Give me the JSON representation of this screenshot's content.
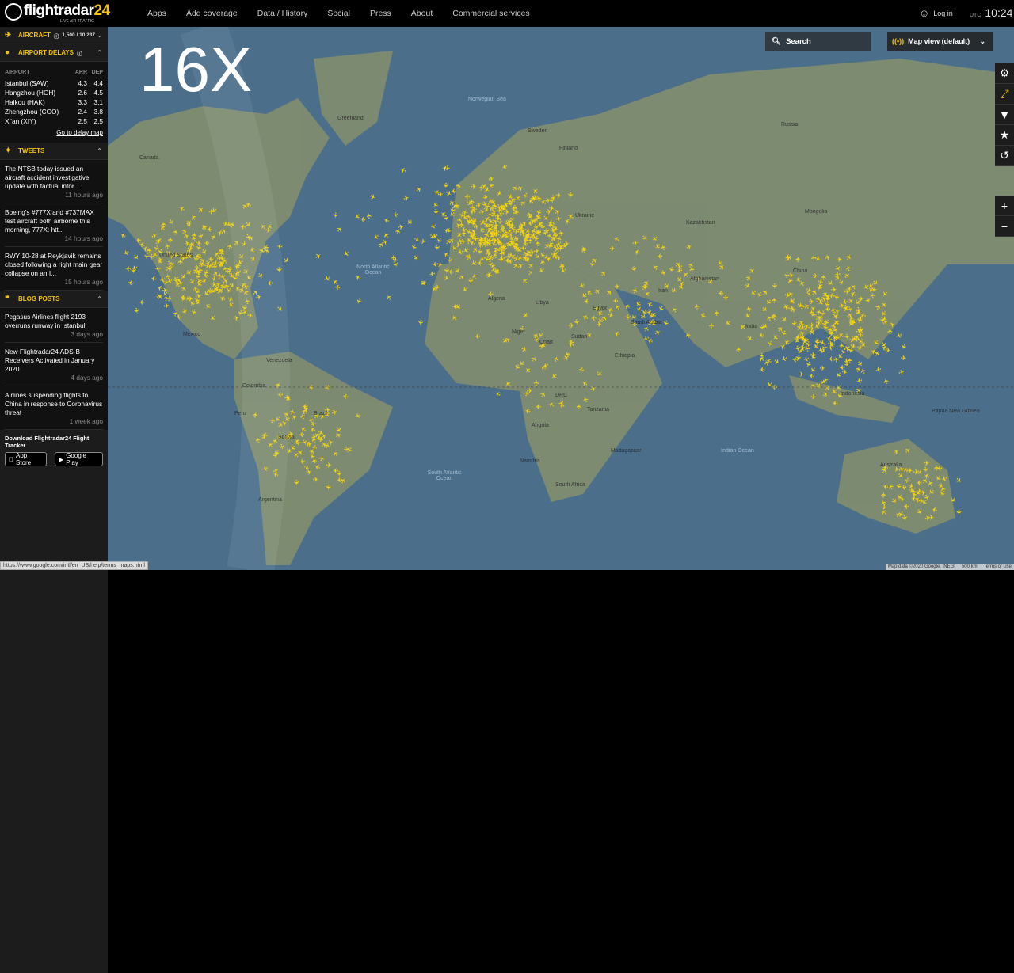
{
  "header": {
    "brand": "flightradar",
    "brand_num": "24",
    "tagline": "LIVE AIR TRAFFIC",
    "nav": [
      "Apps",
      "Add coverage",
      "Data / History",
      "Social",
      "Press",
      "About",
      "Commercial services"
    ],
    "login": "Log in",
    "tz": "UTC",
    "time": "10:24"
  },
  "sidebar": {
    "aircraft": {
      "label": "AIRCRAFT",
      "count": "1,500 / 10,237"
    },
    "delays": {
      "label": "AIRPORT DELAYS",
      "cols": [
        "AIRPORT",
        "ARR",
        "DEP"
      ],
      "rows": [
        [
          "Istanbul (SAW)",
          "4.3",
          "4.4"
        ],
        [
          "Hangzhou (HGH)",
          "2.6",
          "4.5"
        ],
        [
          "Haikou (HAK)",
          "3.3",
          "3.1"
        ],
        [
          "Zhengzhou (CGO)",
          "2.4",
          "3.8"
        ],
        [
          "Xi'an (XIY)",
          "2.5",
          "2.5"
        ]
      ],
      "link": "Go to delay map"
    },
    "tweets": {
      "label": "TWEETS",
      "items": [
        {
          "text": "The NTSB today issued an aircraft accident investigative update with factual infor...",
          "time": "11 hours ago"
        },
        {
          "text": "Boeing's #777X and #737MAX test aircraft both airborne this morning, 777X: htt...",
          "time": "14 hours ago"
        },
        {
          "text": "RWY 10-28 at Reykjavik remains closed following a right main gear collapse on an I...",
          "time": "15 hours ago"
        }
      ]
    },
    "blog": {
      "label": "BLOG POSTS",
      "items": [
        {
          "text": "Pegasus Airlines flight 2193 overruns runway in Istanbul",
          "time": "3 days ago"
        },
        {
          "text": "New Flightradar24 ADS-B Receivers Activated in January 2020",
          "time": "4 days ago"
        },
        {
          "text": "Airlines suspending flights to China in response to Coronavirus threat",
          "time": "1 week ago"
        }
      ]
    },
    "download": {
      "label": "Download Flightradar24 Flight Tracker",
      "app_store": "App Store",
      "google_play": "Google Play"
    }
  },
  "map": {
    "speed_overlay": "16X",
    "search_placeholder": "Search",
    "view": "Map view (default)",
    "labels": {
      "greenland": "Greenland",
      "canada": "Canada",
      "us": "United States",
      "mexico": "Mexico",
      "venezuela": "Venezuela",
      "colombia": "Colombia",
      "brazil": "Brazil",
      "bolivia": "Bolivia",
      "argentina": "Argentina",
      "peru": "Peru",
      "n_atlantic": "North Atlantic Ocean",
      "s_atlantic": "South Atlantic Ocean",
      "indian": "Indian Ocean",
      "algeria": "Algeria",
      "libya": "Libya",
      "egypt": "Egypt",
      "niger": "Niger",
      "sudan": "Sudan",
      "chad": "Chad",
      "ethiopia": "Ethiopia",
      "drc": "DRC",
      "angola": "Angola",
      "tanzania": "Tanzania",
      "namibia": "Namibia",
      "south_africa": "South Africa",
      "madagascar": "Madagascar",
      "kazakhstan": "Kazakhstan",
      "russia": "Russia",
      "ukraine": "Ukraine",
      "finland": "Finland",
      "sweden": "Sweden",
      "iran": "Iran",
      "afghanistan": "Afghanistan",
      "india": "India",
      "china": "China",
      "mongolia": "Mongolia",
      "australia": "Australia",
      "indonesia": "Indonesia",
      "papua": "Papua New Guinea",
      "norwegian_sea": "Norwegian Sea",
      "saudi": "Saudi Arabia"
    },
    "attribution": "Map data ©2020 Google, INEGI",
    "scale": "500 km",
    "terms": "Terms of Use",
    "status_url": "https://www.google.com/intl/en_US/help/terms_maps.html"
  },
  "colors": {
    "accent": "#f2c40a",
    "plane": "#f5d312",
    "ocean": "#4b6e8b",
    "land": "#7d8a6e"
  }
}
